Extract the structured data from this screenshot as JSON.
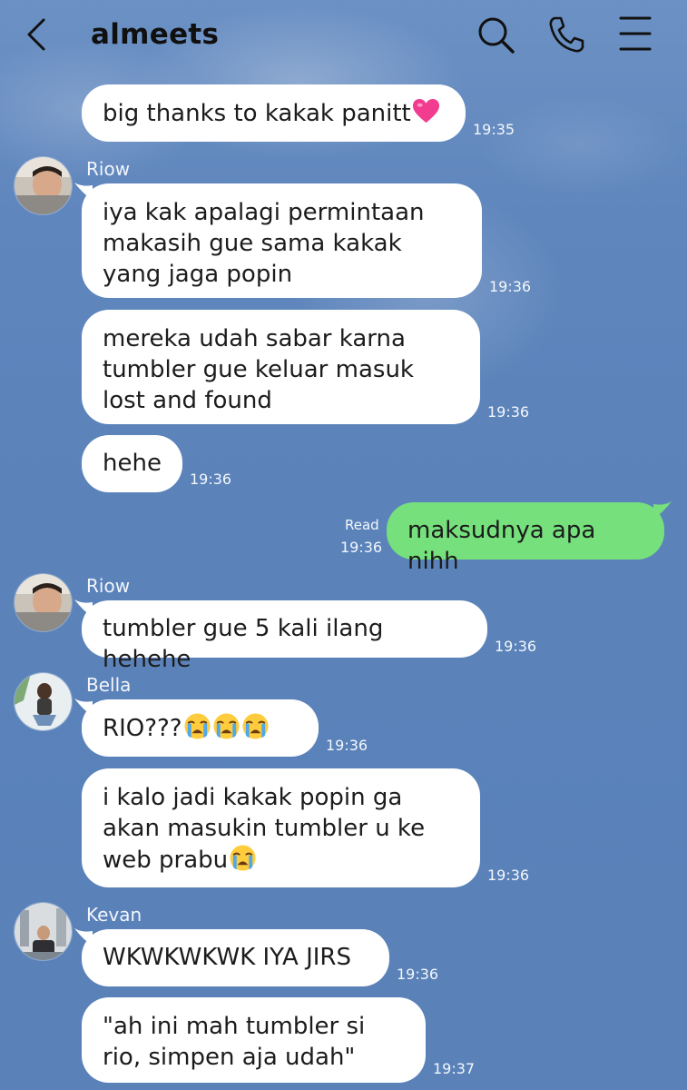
{
  "header": {
    "title": "almeets"
  },
  "messages": [
    {
      "text": "big thanks to kakak panitt",
      "time": "19:35"
    },
    {
      "sender": "Riow",
      "text": "iya kak apalagi permintaan makasih gue sama kakak yang jaga popin",
      "time": "19:36"
    },
    {
      "text": "mereka udah sabar karna tumbler gue keluar masuk lost and found",
      "time": "19:36"
    },
    {
      "text": "hehe",
      "time": "19:36"
    },
    {
      "text": "maksudnya apa nihh",
      "status": "Read",
      "time": "19:36"
    },
    {
      "sender": "Riow",
      "text": "tumbler gue 5 kali ilang hehehe",
      "time": "19:36"
    },
    {
      "sender": "Bella",
      "text": "RIO???",
      "time": "19:36"
    },
    {
      "text": "i kalo jadi kakak popin ga akan masukin tumbler u ke web prabu",
      "time": "19:36"
    },
    {
      "sender": "Kevan",
      "text": "WKWKWKWK IYA JIRS",
      "time": "19:36"
    },
    {
      "text": "\"ah ini mah tumbler si rio, simpen aja udah\"",
      "time": "19:37"
    }
  ],
  "icons": {
    "back": "chevron-left-icon",
    "search": "search-icon",
    "call": "phone-icon",
    "menu": "menu-icon",
    "heart": "pink-heart-emoji",
    "crying": "loudly-crying-face-emoji"
  },
  "colors": {
    "background": "#5b83ba",
    "incoming_bubble": "#ffffff",
    "outgoing_bubble": "#76e07d",
    "heart": "#f23c8f"
  }
}
